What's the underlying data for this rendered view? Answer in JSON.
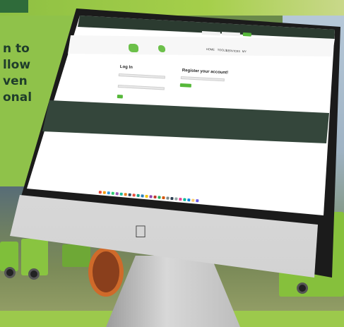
{
  "poster": {
    "lines": [
      "n to",
      "llow",
      "ven",
      "onal"
    ]
  },
  "screen_site": {
    "login_heading": "Log In",
    "register_heading": "Register your account!",
    "nav_items": [
      "HOME",
      "TOOLS",
      "SERVICES",
      "MY"
    ],
    "colors": {
      "accent": "#56b83a",
      "dark_band": "#34463b",
      "top_bar": "#2b3b30"
    }
  },
  "decor": {
    "logo_icon": "apple-logo-icon",
    "dock_icon_colors": [
      "#e84c3d",
      "#f39c12",
      "#3498db",
      "#2ecc71",
      "#9b59b6",
      "#1abc9c",
      "#e67e22",
      "#34495e",
      "#e74c3c",
      "#16a085",
      "#2980b9",
      "#f1c40f",
      "#8e44ad",
      "#c0392b",
      "#27ae60",
      "#d35400",
      "#7f8c8d",
      "#2c3e50",
      "#95a5a6",
      "#e84393",
      "#00b894",
      "#0984e3",
      "#fdcb6e",
      "#6c5ce7"
    ]
  }
}
